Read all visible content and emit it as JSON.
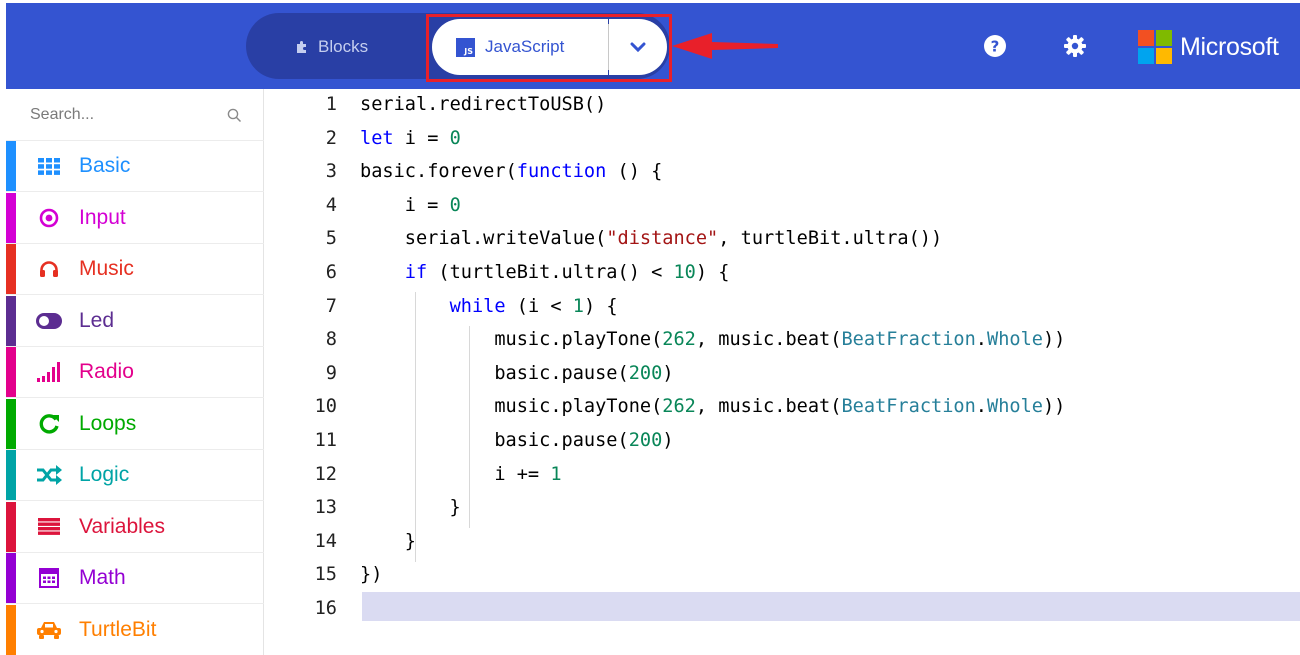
{
  "header": {
    "tabs": [
      {
        "label": "Blocks",
        "icon": "puzzle-icon",
        "active": false
      },
      {
        "label": "JavaScript",
        "icon": "js-icon",
        "active": true
      }
    ],
    "js_icon_text": "JS",
    "dropdown_icon": "chevron-down-icon",
    "help_icon": "help-icon",
    "settings_icon": "gear-icon",
    "brand": "Microsoft",
    "bar_color": "#3454d1",
    "highlight_color": "#e8202a"
  },
  "sidebar": {
    "search": {
      "placeholder": "Search..."
    },
    "categories": [
      {
        "label": "Basic",
        "icon": "grid-icon",
        "color": "#1e90ff"
      },
      {
        "label": "Input",
        "icon": "target-icon",
        "color": "#d400d4"
      },
      {
        "label": "Music",
        "icon": "headphones-icon",
        "color": "#e63022"
      },
      {
        "label": "Led",
        "icon": "toggle-icon",
        "color": "#5c2d91"
      },
      {
        "label": "Radio",
        "icon": "signal-bars-icon",
        "color": "#e3008c"
      },
      {
        "label": "Loops",
        "icon": "refresh-icon",
        "color": "#00aa00"
      },
      {
        "label": "Logic",
        "icon": "shuffle-icon",
        "color": "#00a4a6"
      },
      {
        "label": "Variables",
        "icon": "list-icon",
        "color": "#dc143c"
      },
      {
        "label": "Math",
        "icon": "calculator-icon",
        "color": "#9400d3"
      },
      {
        "label": "TurtleBit",
        "icon": "car-icon",
        "color": "#ff7f00"
      }
    ]
  },
  "editor": {
    "lines": [
      {
        "n": "1",
        "code": "serial.redirectToUSB()"
      },
      {
        "n": "2",
        "code": "let i = 0"
      },
      {
        "n": "3",
        "code": "basic.forever(function () {"
      },
      {
        "n": "4",
        "code": "    i = 0"
      },
      {
        "n": "5",
        "code": "    serial.writeValue(\"distance\", turtleBit.ultra())"
      },
      {
        "n": "6",
        "code": "    if (turtleBit.ultra() < 10) {"
      },
      {
        "n": "7",
        "code": "        while (i < 1) {"
      },
      {
        "n": "8",
        "code": "            music.playTone(262, music.beat(BeatFraction.Whole))"
      },
      {
        "n": "9",
        "code": "            basic.pause(200)"
      },
      {
        "n": "10",
        "code": "            music.playTone(262, music.beat(BeatFraction.Whole))"
      },
      {
        "n": "11",
        "code": "            basic.pause(200)"
      },
      {
        "n": "12",
        "code": "            i += 1"
      },
      {
        "n": "13",
        "code": "        }"
      },
      {
        "n": "14",
        "code": "    }"
      },
      {
        "n": "15",
        "code": "})"
      },
      {
        "n": "16",
        "code": ""
      }
    ],
    "current_line": "16",
    "syntax_colors": {
      "keyword": "#0000ff",
      "number": "#098658",
      "string": "#a31515",
      "class": "#267f99"
    }
  }
}
